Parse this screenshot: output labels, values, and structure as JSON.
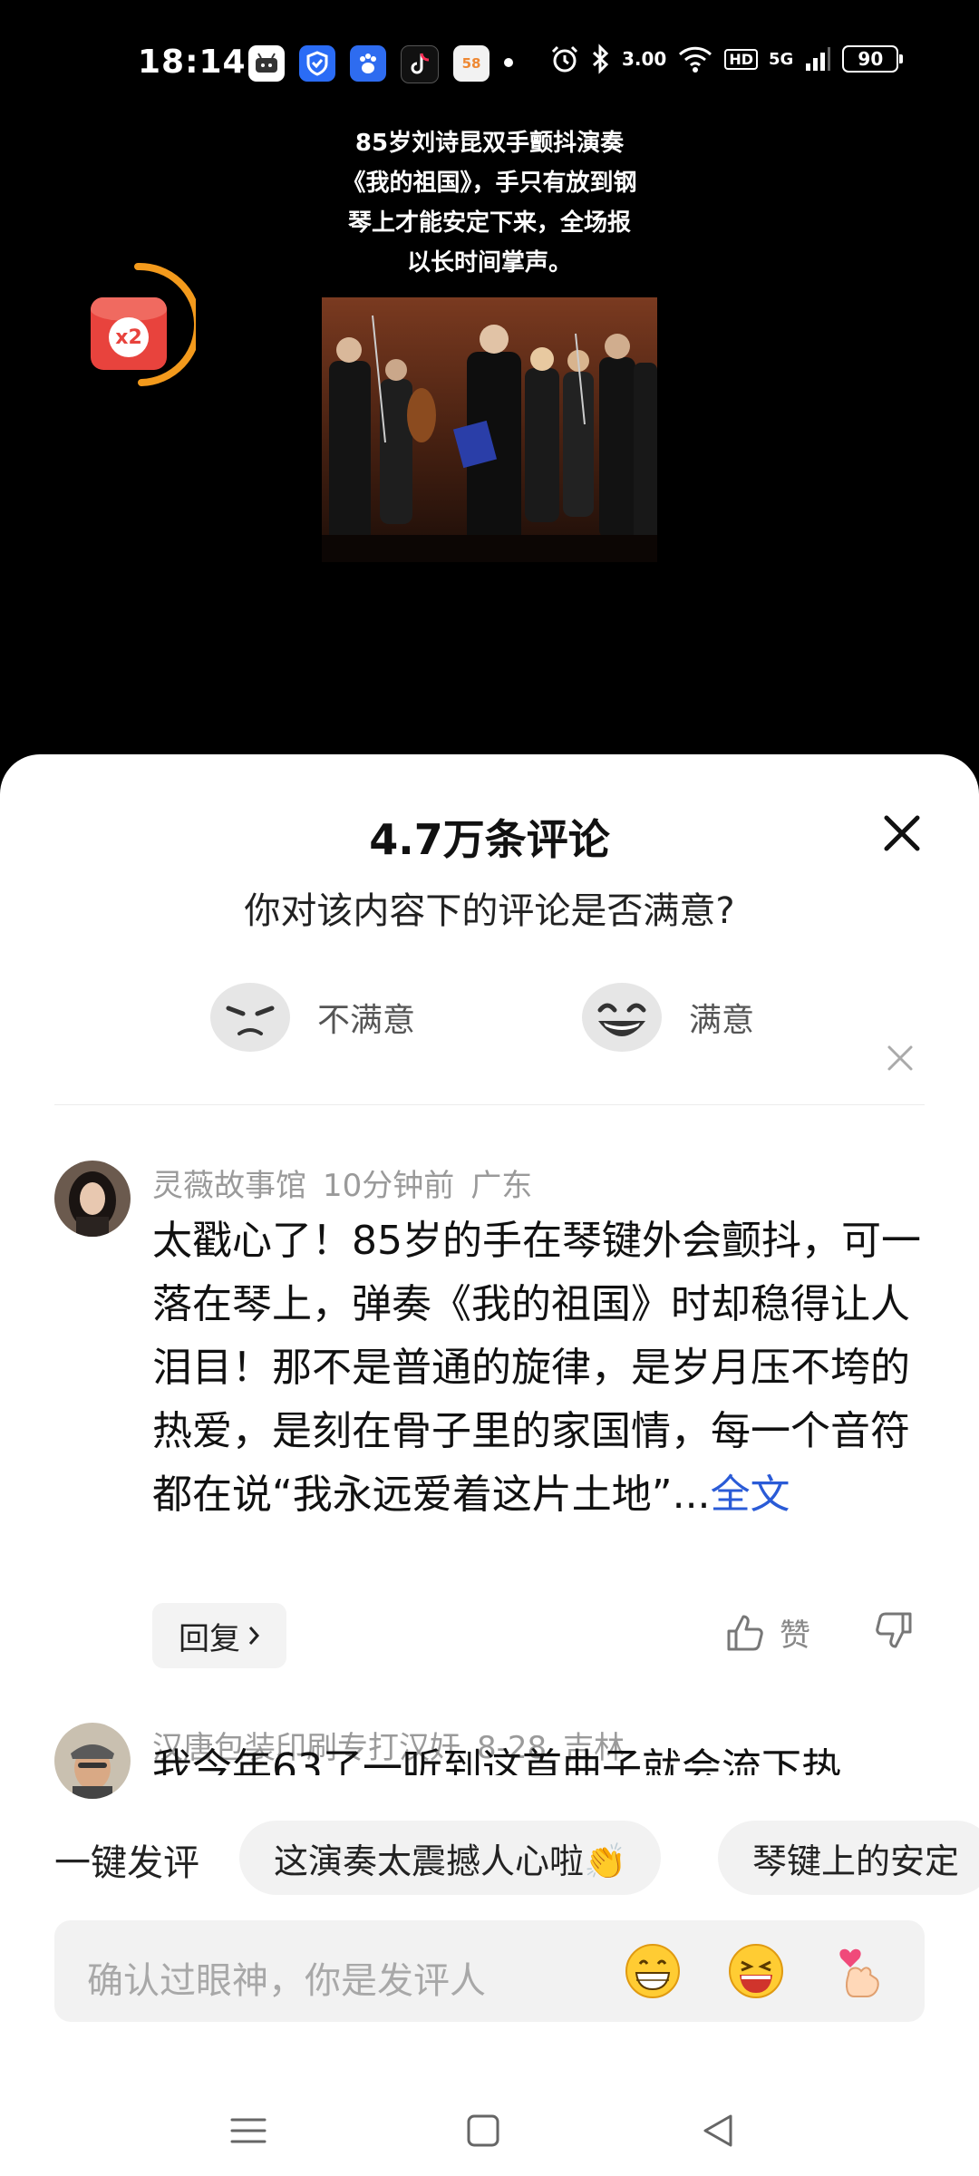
{
  "status_bar": {
    "time": "18:14",
    "speed": "3.00",
    "hd": "HD",
    "network": "5G",
    "battery": "90",
    "app_icons": [
      "bilibili-icon",
      "shield-icon",
      "baidu-icon",
      "tiktok-icon",
      "58-icon"
    ],
    "app5_label": "58"
  },
  "video": {
    "caption": "85岁刘诗昆双手颤抖演奏《我的祖国》，手只有放到钢琴上才能安定下来，全场报以长时间掌声。",
    "red_packet_label": "x2"
  },
  "sheet": {
    "title": "4.7万条评论",
    "survey": {
      "question": "你对该内容下的评论是否满意?",
      "negative_label": "不满意",
      "positive_label": "满意"
    }
  },
  "comments": [
    {
      "author": "灵薇故事馆",
      "time": "10分钟前",
      "location": "广东",
      "text": "太戳心了！85岁的手在琴键外会颤抖，可一落在琴上，弹奏《我的祖国》时却稳得让人泪目！那不是普通的旋律，是岁月压不垮的热爱，是刻在骨子里的家国情，每一个音符都在说“我永远爱着这片土地”...",
      "more_label": "全文",
      "reply_label": "回复",
      "like_label": "赞"
    },
    {
      "author": "汉唐包装印刷专打汉奸",
      "time": "8-28",
      "location": "吉林",
      "text_preview": "我今年63了一听到这首曲子就会流下热"
    }
  ],
  "quick_comment": {
    "label": "一键发评",
    "chips": [
      "这演奏太震撼人心啦👏",
      "琴键上的安定"
    ]
  },
  "input": {
    "placeholder": "确认过眼神，你是发评人",
    "emojis": [
      "grin-emoji",
      "laugh-emoji",
      "finger-heart-emoji"
    ]
  },
  "nav": [
    "menu-icon",
    "home-icon",
    "back-icon"
  ],
  "colors": {
    "accent_link": "#2a5bd7",
    "red_packet": "#e8433d",
    "ring": "#f39a1c"
  }
}
